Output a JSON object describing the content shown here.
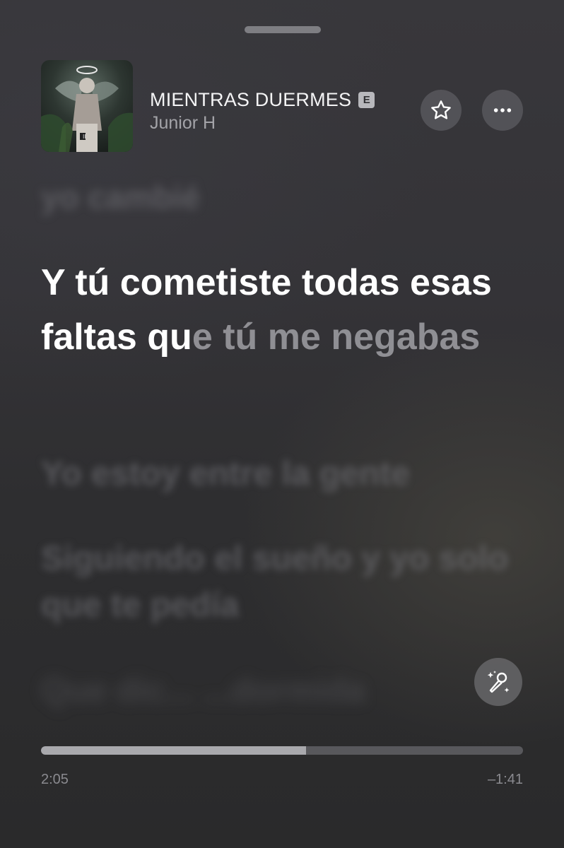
{
  "now_playing": {
    "title": "MIENTRAS DUERMES",
    "explicit_badge": "E",
    "artist": "Junior H",
    "artwork_icon": "album-artwork"
  },
  "controls": {
    "favorite_icon": "star-icon",
    "more_icon": "ellipsis-icon",
    "sing_icon": "microphone-sparkle-icon"
  },
  "lyrics": {
    "previous": "yo cambié",
    "current_sung": "Y tú cometiste todas esas faltas qu",
    "current_unsung": "e tú me negabas",
    "next": [
      "Yo estoy entre la gente",
      "Siguiendo el sueño y yo solo que te pedía",
      "Que dic... ...dormida"
    ]
  },
  "playback": {
    "elapsed": "2:05",
    "remaining": "–1:41",
    "progress_fraction": 0.55
  },
  "colors": {
    "accent": "#ffffff",
    "background": "#333236"
  }
}
